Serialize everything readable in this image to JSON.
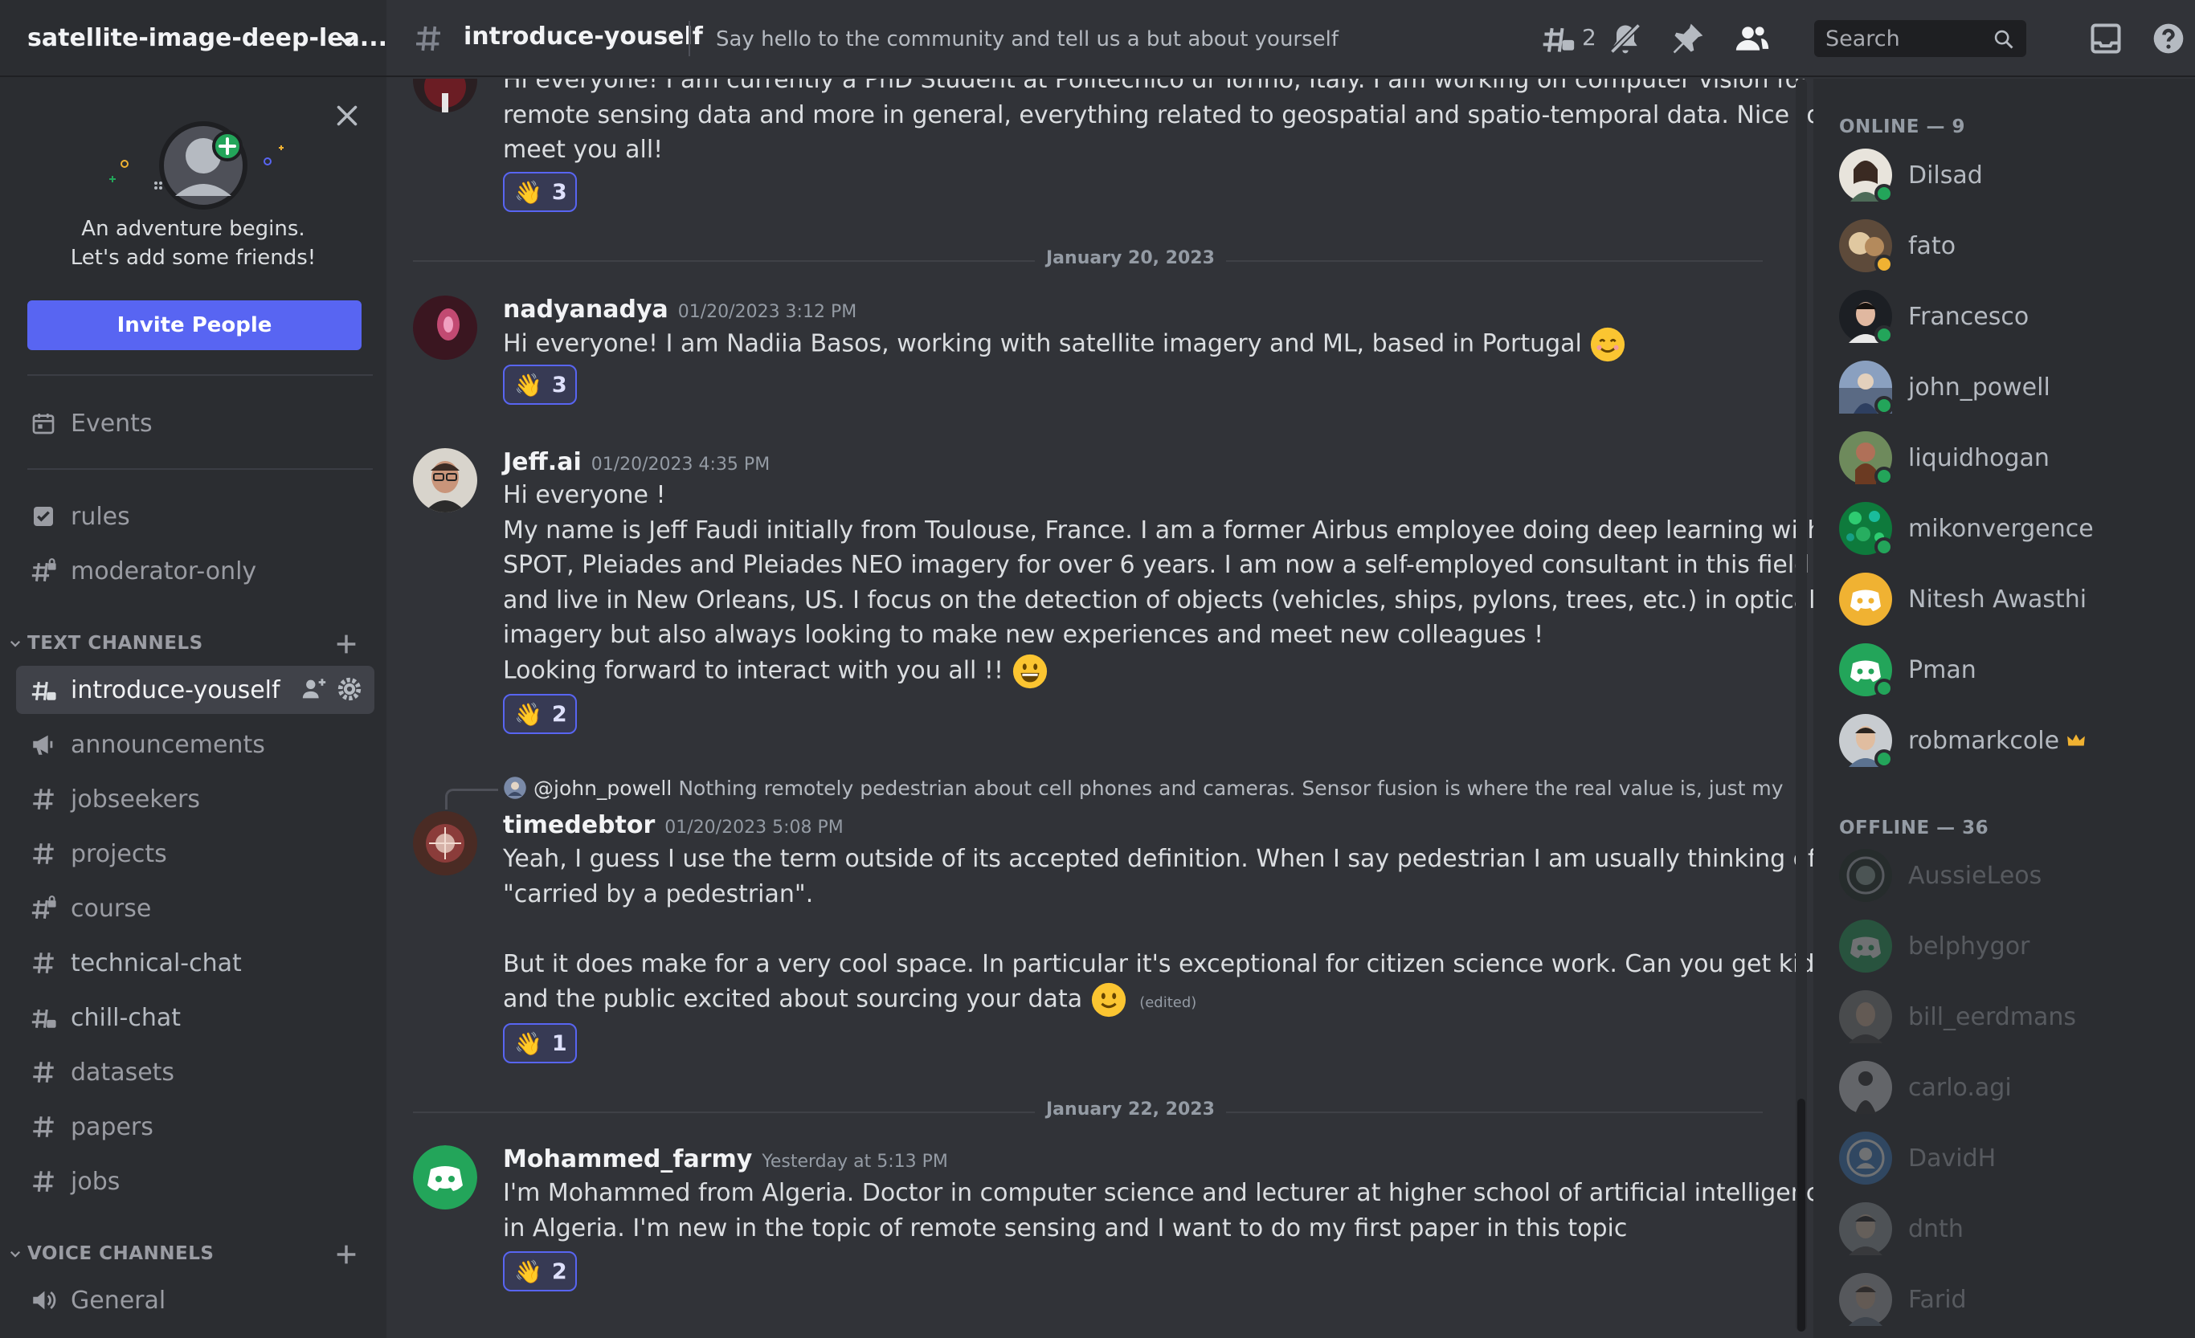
{
  "server": {
    "name": "satellite-image-deep-lea..."
  },
  "welcome": {
    "line1": "An adventure begins.",
    "line2": "Let's add some friends!",
    "invite_label": "Invite People"
  },
  "sidebar": {
    "events_label": "Events",
    "rules_label": "rules",
    "moderator_label": "moderator-only",
    "text_category": "TEXT CHANNELS",
    "voice_category": "VOICE CHANNELS",
    "text_channels": [
      "introduce-youself",
      "announcements",
      "jobseekers",
      "projects",
      "course",
      "technical-chat",
      "chill-chat",
      "datasets",
      "papers",
      "jobs"
    ],
    "voice_channels": [
      "General"
    ]
  },
  "topbar": {
    "channel": "introduce-youself",
    "topic": "Say hello to the community and tell us a but about yourself",
    "threads_count": "2",
    "search_placeholder": "Search"
  },
  "messages": {
    "m0": {
      "lines": [
        "Hi everyone! I am currently a PhD Student at Politecnico di Torino, Italy. I am working on computer vision for",
        "remote sensing data and more in general, everything related to geospatial and spatio-temporal data. Nice to",
        "meet you all!"
      ],
      "reaction_count": "3"
    },
    "date1": "January 20, 2023",
    "m1": {
      "author": "nadyanadya",
      "time": "01/20/2023 3:12 PM",
      "text": "Hi everyone! I am Nadiia Basos, working with satellite imagery and ML, based in Portugal",
      "reaction_count": "3"
    },
    "m2": {
      "author": "Jeff.ai",
      "time": "01/20/2023 4:35 PM",
      "lines": [
        "Hi everyone !",
        "My name is Jeff Faudi initially from Toulouse, France. I am a former Airbus employee doing deep learning with",
        "SPOT, Pleiades and Pleiades NEO imagery for over 6 years. I am now a self-employed consultant in this field",
        "and live in New Orleans, US. I focus on the detection of objects (vehicles, ships, pylons, trees, etc.) in optical",
        "imagery but also always looking to make new experiences and meet new colleagues !",
        "Looking forward to interact with you all !!"
      ],
      "reaction_count": "2"
    },
    "m3": {
      "reply_author": "@john_powell",
      "reply_text": "Nothing remotely pedestrian about cell phones and cameras. Sensor fusion is where the real value is, just my",
      "author": "timedebtor",
      "time": "01/20/2023 5:08 PM",
      "lines": [
        "Yeah, I guess I use the term outside of its accepted definition. When I say pedestrian I am usually thinking of",
        "\"carried by a pedestrian\".",
        "",
        "But it does make for a very cool space. In particular it's exceptional for citizen science work. Can you get kids",
        "and the public excited about sourcing your data"
      ],
      "edited": "(edited)",
      "reaction_count": "1"
    },
    "date2": "January 22, 2023",
    "m4": {
      "author": "Mohammed_farmy",
      "time": "Yesterday at 5:13 PM",
      "lines": [
        "I'm Mohammed from Algeria. Doctor in computer science and lecturer at higher school of artificial intelligence",
        "in Algeria. I'm new in the topic of remote sensing and I want to do my first paper in this topic"
      ],
      "reaction_count": "2"
    }
  },
  "members": {
    "online_header": "ONLINE — 9",
    "offline_header": "OFFLINE — 36",
    "online": [
      "Dilsad",
      "fato",
      "Francesco",
      "john_powell",
      "liquidhogan",
      "mikonvergence",
      "Nitesh Awasthi",
      "Pman",
      "robmarkcole"
    ],
    "offline": [
      "AussieLeos",
      "belphygor",
      "bill_eerdmans",
      "carlo.agi",
      "DavidH",
      "dnth",
      "Farid"
    ]
  },
  "colors": {
    "accent": "#5865f2",
    "online_status": "#23a55a",
    "background": "#313338",
    "sidebar": "#2b2d31"
  }
}
